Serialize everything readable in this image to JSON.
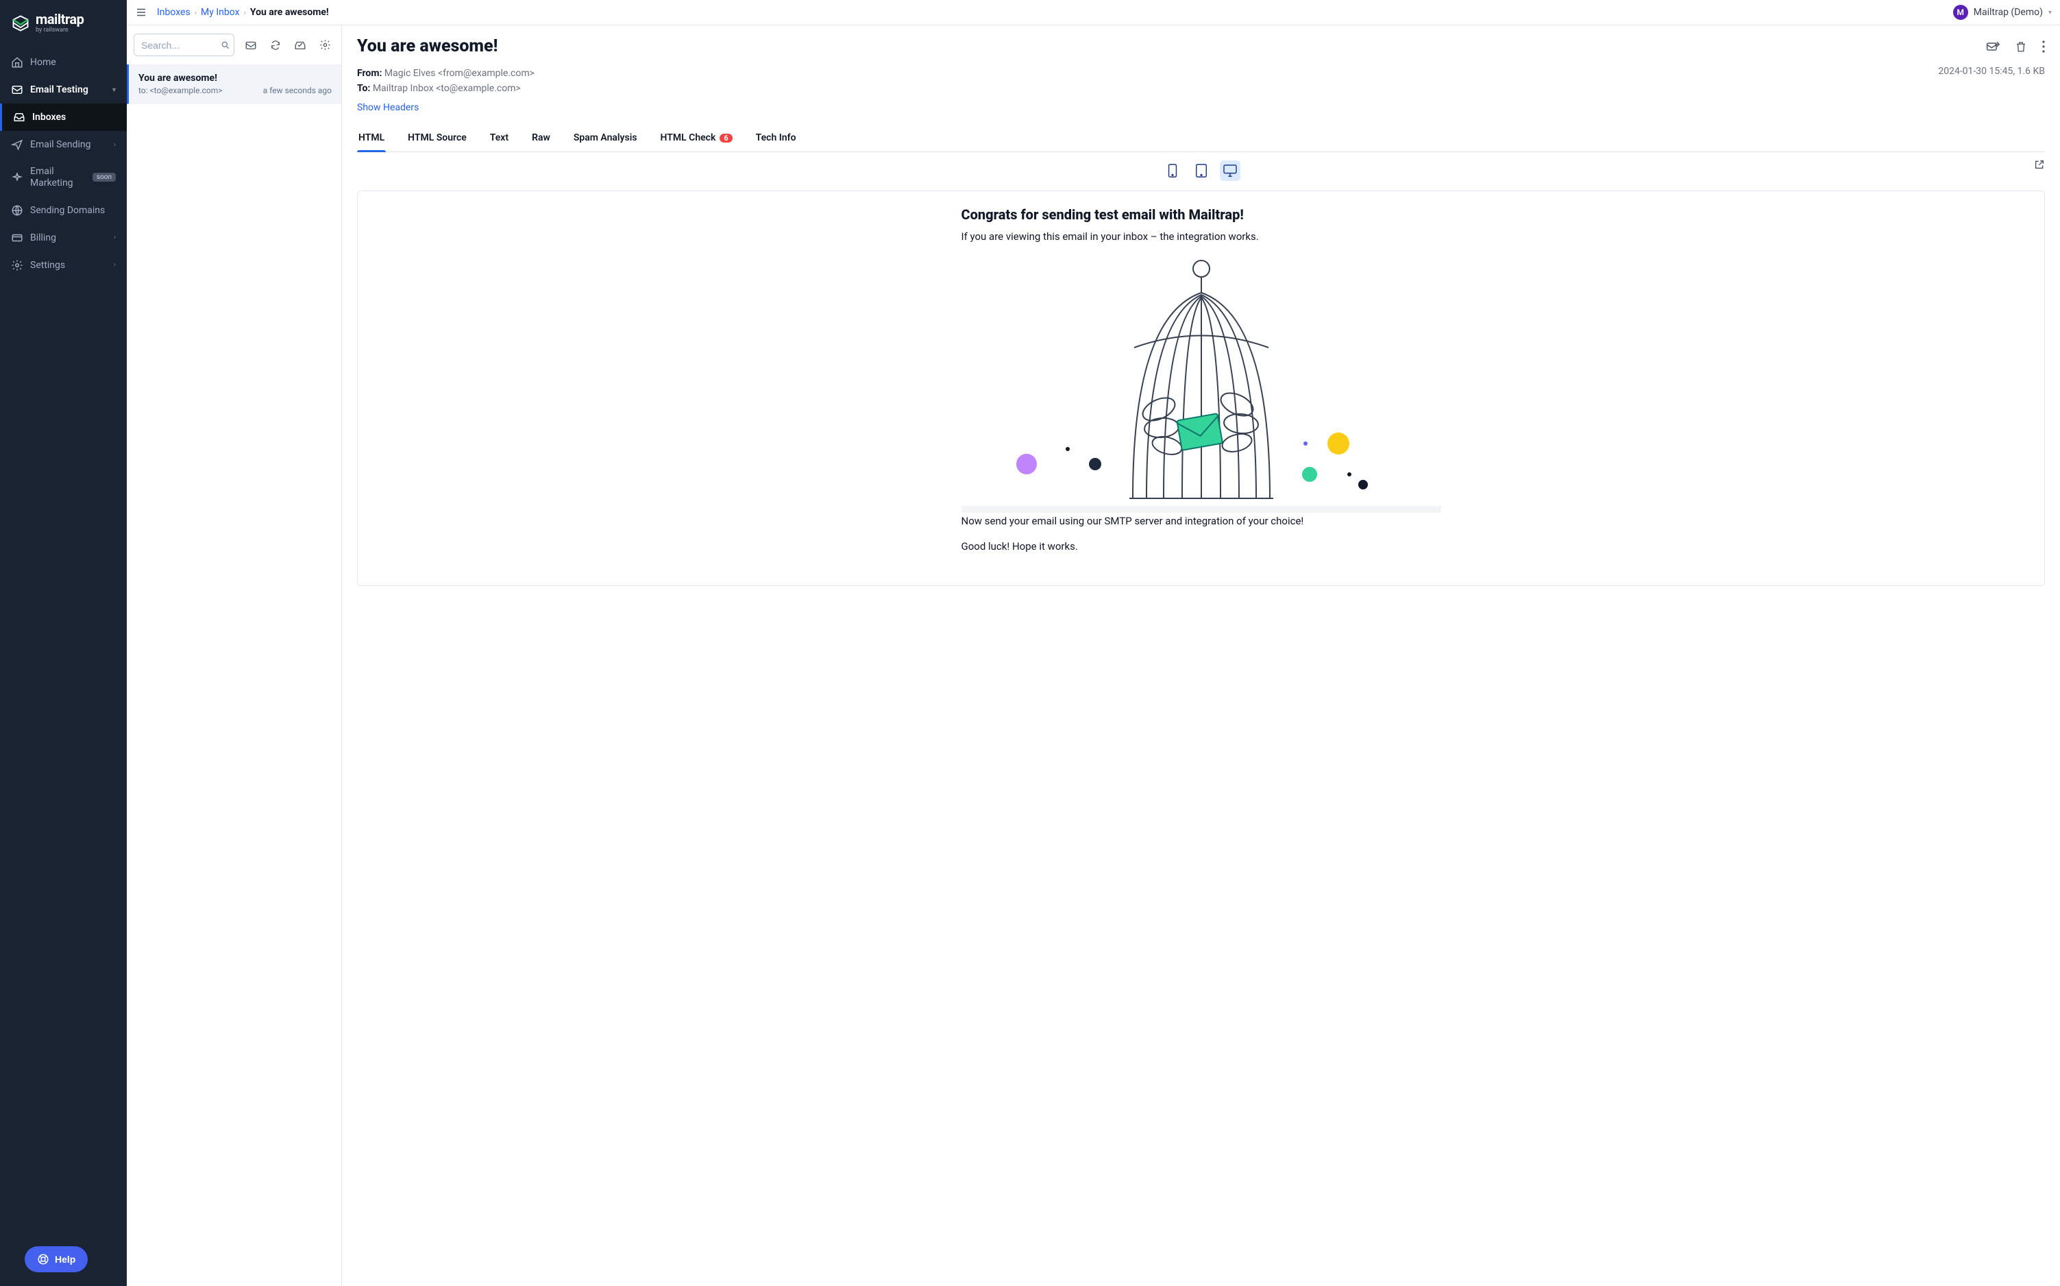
{
  "brand": {
    "name": "mailtrap",
    "byline": "by railsware"
  },
  "nav": {
    "home": "Home",
    "email_testing": "Email Testing",
    "inboxes": "Inboxes",
    "email_sending": "Email Sending",
    "email_marketing": "Email Marketing",
    "marketing_badge": "soon",
    "sending_domains": "Sending Domains",
    "billing": "Billing",
    "settings": "Settings",
    "help": "Help"
  },
  "breadcrumb": {
    "l1": "Inboxes",
    "l2": "My Inbox",
    "current": "You are awesome!"
  },
  "account": {
    "initial": "M",
    "name": "Mailtrap (Demo)"
  },
  "list": {
    "search_placeholder": "Search...",
    "item": {
      "subject": "You are awesome!",
      "to_line": "to: <to@example.com>",
      "time": "a few seconds ago"
    }
  },
  "detail": {
    "title": "You are awesome!",
    "from_label": "From:",
    "from_value": "Magic Elves <from@example.com>",
    "to_label": "To:",
    "to_value": "Mailtrap Inbox <to@example.com>",
    "timestamp": "2024-01-30 15:45, 1.6 KB",
    "show_headers": "Show Headers",
    "tabs": {
      "html": "HTML",
      "html_source": "HTML Source",
      "text": "Text",
      "raw": "Raw",
      "spam": "Spam Analysis",
      "html_check": "HTML Check",
      "html_check_badge": "6",
      "tech": "Tech Info"
    }
  },
  "email": {
    "h1": "Congrats for sending test email with Mailtrap!",
    "p1": "If you are viewing this email in your inbox – the integration works.",
    "p2": "Now send your email using our SMTP server and integration of your choice!",
    "p3": "Good luck! Hope it works."
  }
}
